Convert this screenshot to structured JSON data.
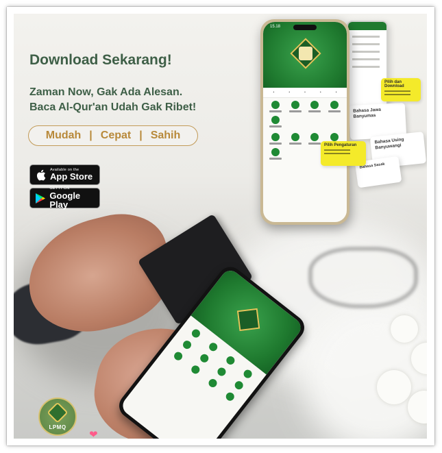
{
  "headline": "Download Sekarang!",
  "subheadline": {
    "line1": "Zaman Now, Gak Ada Alesan.",
    "line2": "Baca Al-Qur'an Udah Gak Ribet!"
  },
  "features": [
    "Mudah",
    "Cepat",
    "Sahih"
  ],
  "stores": {
    "apple": {
      "small": "Available on the",
      "big": "App Store",
      "icon": "apple-icon"
    },
    "google": {
      "small": "GET IT ON",
      "big": "Google Play",
      "icon": "google-play-icon"
    }
  },
  "phone_main": {
    "time": "15.18"
  },
  "tooltips": {
    "download": "Pilih dan Download",
    "language": "Pilih Pengaturan"
  },
  "cards": {
    "card1": "Bahasa Jawa Banyumas",
    "card2": "Bahasa Using Banyuwangi",
    "card3": "Bahasa Sasak"
  },
  "logo": {
    "label": "LPMQ"
  },
  "colors": {
    "headline_green": "#3e5f47",
    "feature_gold": "#b8893a",
    "app_green": "#1f7a2f",
    "tooltip_yellow": "#f4ea2a"
  }
}
